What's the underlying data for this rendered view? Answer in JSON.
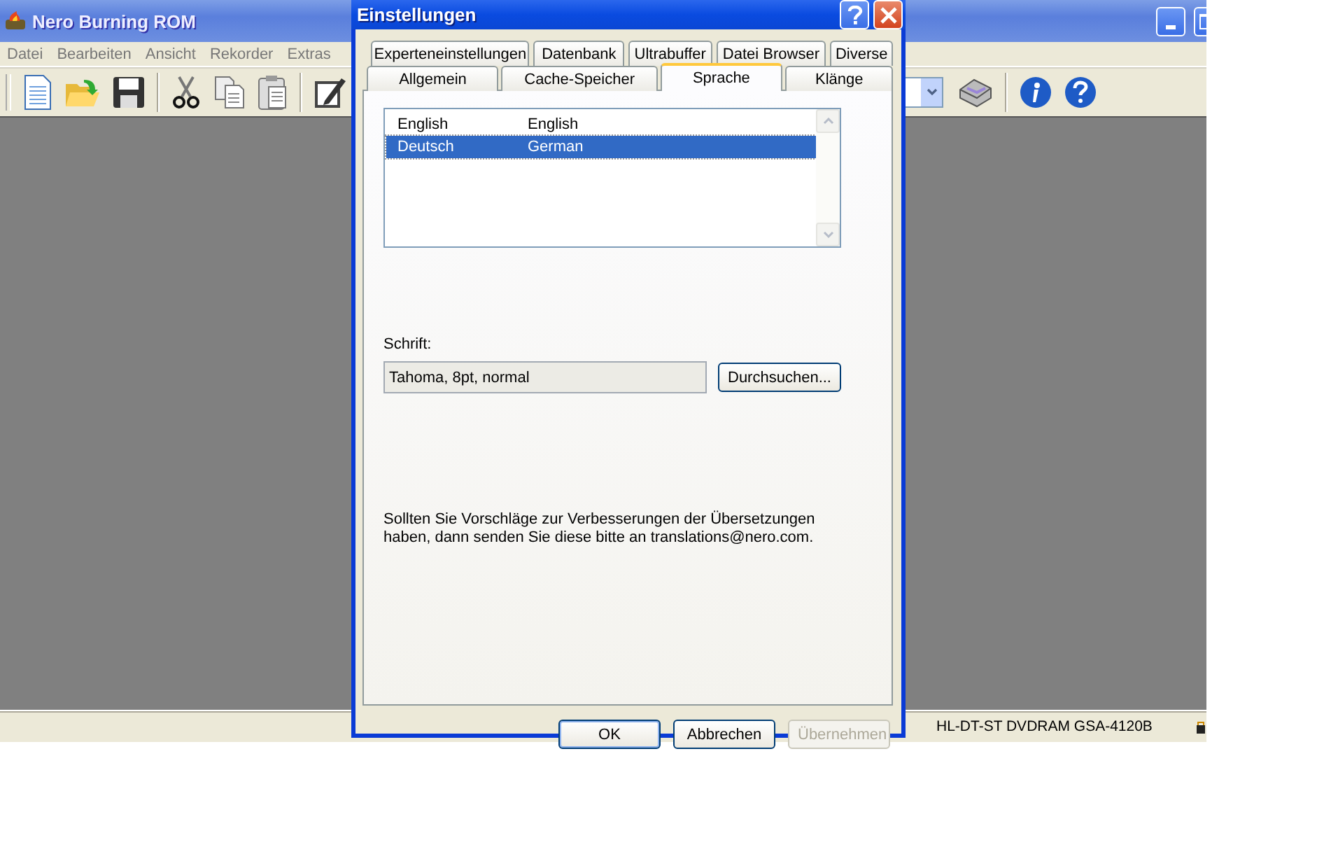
{
  "main_window": {
    "title": "Nero Burning ROM",
    "menu": [
      "Datei",
      "Bearbeiten",
      "Ansicht",
      "Rekorder",
      "Extras"
    ],
    "status_bar": {
      "drive": "HL-DT-ST DVDRAM GSA-4120B"
    }
  },
  "dialog": {
    "title": "Einstellungen",
    "tab_rows": [
      [
        {
          "label": "Experteneinstellungen",
          "selected": false
        },
        {
          "label": "Datenbank",
          "selected": false
        },
        {
          "label": "Ultrabuffer",
          "selected": false
        },
        {
          "label": "Datei Browser",
          "selected": false
        },
        {
          "label": "Diverse",
          "selected": false
        }
      ],
      [
        {
          "label": "Allgemein",
          "selected": false
        },
        {
          "label": "Cache-Speicher",
          "selected": false
        },
        {
          "label": "Sprache",
          "selected": true
        },
        {
          "label": "Klänge",
          "selected": false
        }
      ]
    ],
    "languages": [
      {
        "name": "English",
        "native": "English",
        "selected": false
      },
      {
        "name": "Deutsch",
        "native": "German",
        "selected": true
      }
    ],
    "font": {
      "label": "Schrift:",
      "value": "Tahoma, 8pt, normal",
      "browse": "Durchsuchen..."
    },
    "note": "Sollten Sie Vorschläge zur Verbesserungen der Übersetzungen\nhaben, dann senden Sie diese bitte an translations@nero.com.",
    "buttons": [
      {
        "label": "OK",
        "kind": "default",
        "disabled": false
      },
      {
        "label": "Abbrechen",
        "kind": "normal",
        "disabled": false
      },
      {
        "label": "Übernehmen",
        "kind": "normal",
        "disabled": true
      }
    ]
  }
}
